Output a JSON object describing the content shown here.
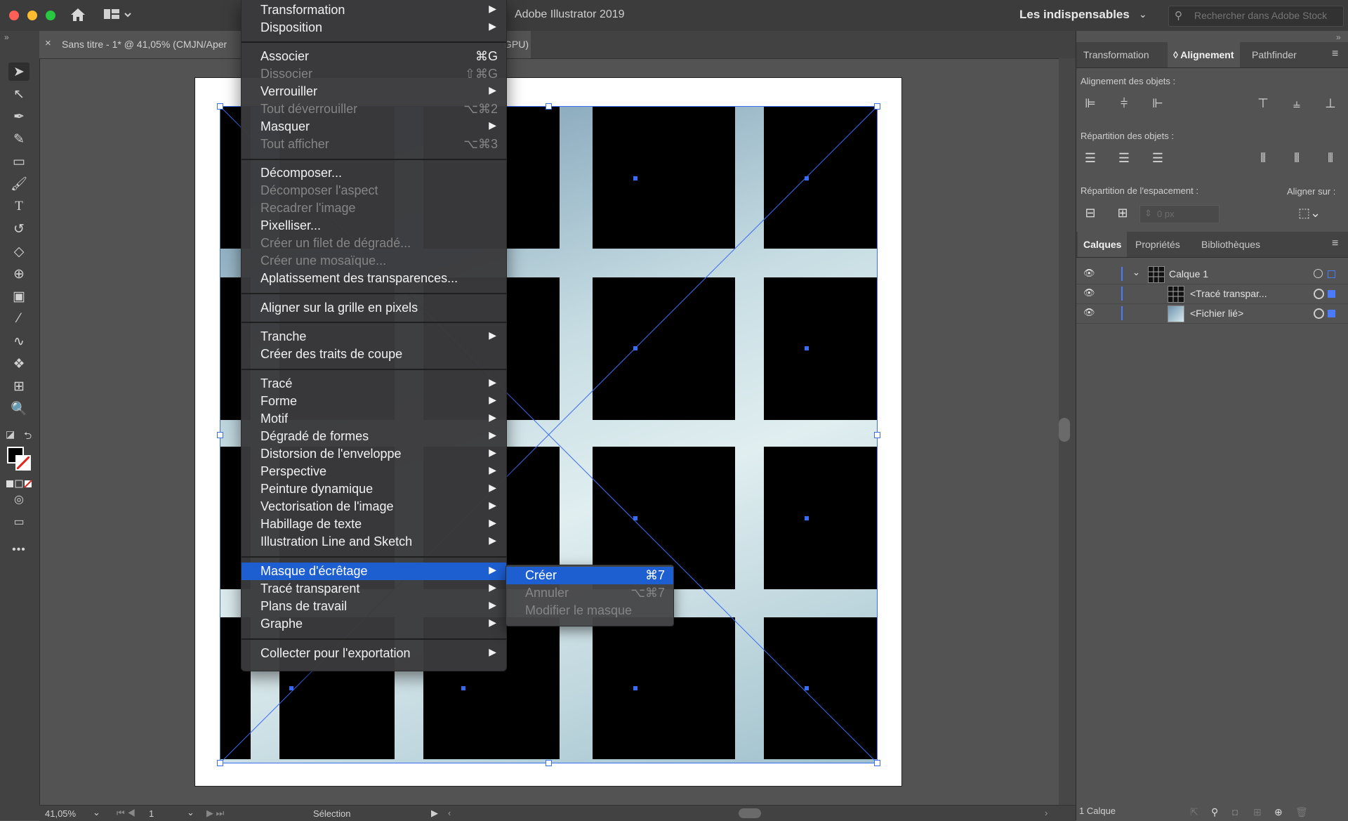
{
  "app": {
    "title": "Adobe Illustrator 2019",
    "workspace": "Les indispensables",
    "stock_search_placeholder": "Rechercher dans Adobe Stock"
  },
  "doc_tab": {
    "title": "Sans titre - 1* @ 41,05% (CMJN/Aper",
    "title_tail": "GPU)"
  },
  "menu": {
    "items": [
      {
        "label": "Transformation",
        "submenu": true
      },
      {
        "label": "Disposition",
        "submenu": true
      },
      {
        "label": "Associer",
        "shortcut": "⌘G"
      },
      {
        "label": "Dissocier",
        "shortcut": "⇧⌘G",
        "disabled": true
      },
      {
        "label": "Verrouiller",
        "submenu": true
      },
      {
        "label": "Tout déverrouiller",
        "shortcut": "⌥⌘2",
        "disabled": true
      },
      {
        "label": "Masquer",
        "submenu": true
      },
      {
        "label": "Tout afficher",
        "shortcut": "⌥⌘3",
        "disabled": true
      },
      {
        "label": "Décomposer..."
      },
      {
        "label": "Décomposer l'aspect",
        "disabled": true
      },
      {
        "label": "Recadrer l'image",
        "disabled": true
      },
      {
        "label": "Pixelliser..."
      },
      {
        "label": "Créer un filet de dégradé...",
        "disabled": true
      },
      {
        "label": "Créer une mosaïque...",
        "disabled": true
      },
      {
        "label": "Aplatissement des transparences..."
      },
      {
        "label": "Aligner sur la grille en pixels"
      },
      {
        "label": "Tranche",
        "submenu": true
      },
      {
        "label": "Créer des traits de coupe"
      },
      {
        "label": "Tracé",
        "submenu": true
      },
      {
        "label": "Forme",
        "submenu": true
      },
      {
        "label": "Motif",
        "submenu": true
      },
      {
        "label": "Dégradé de formes",
        "submenu": true
      },
      {
        "label": "Distorsion de l'enveloppe",
        "submenu": true
      },
      {
        "label": "Perspective",
        "submenu": true
      },
      {
        "label": "Peinture dynamique",
        "submenu": true
      },
      {
        "label": "Vectorisation de l'image",
        "submenu": true
      },
      {
        "label": "Habillage de texte",
        "submenu": true
      },
      {
        "label": "Illustration Line and Sketch",
        "submenu": true
      },
      {
        "label": "Masque d'écrêtage",
        "submenu": true,
        "highlighted": true
      },
      {
        "label": "Tracé transparent",
        "submenu": true
      },
      {
        "label": "Plans de travail",
        "submenu": true
      },
      {
        "label": "Graphe",
        "submenu": true
      },
      {
        "label": "Collecter pour l'exportation",
        "submenu": true
      }
    ]
  },
  "submenu": {
    "items": [
      {
        "label": "Créer",
        "shortcut": "⌘7",
        "highlighted": true
      },
      {
        "label": "Annuler",
        "shortcut": "⌥⌘7",
        "disabled": true
      },
      {
        "label": "Modifier le masque",
        "disabled": true
      }
    ]
  },
  "status": {
    "zoom": "41,05%",
    "artboard": "1",
    "tool": "Sélection"
  },
  "panels": {
    "top_tabs": [
      "Transformation",
      "Alignement",
      "Pathfinder"
    ],
    "align_objects": "Alignement des objets :",
    "distribute_objects": "Répartition des objets :",
    "distribute_spacing": "Répartition de l'espacement :",
    "align_to": "Aligner sur :",
    "spacing_value": "0 px",
    "layer_tabs": [
      "Calques",
      "Propriétés",
      "Bibliothèques"
    ],
    "layers": [
      {
        "name": "Calque 1"
      },
      {
        "name": "<Tracé transpar..."
      },
      {
        "name": "<Fichier lié>"
      }
    ],
    "layer_count": "1 Calque"
  },
  "colors": {
    "highlight": "#1d5fd1",
    "selection": "#3b6cf6"
  }
}
